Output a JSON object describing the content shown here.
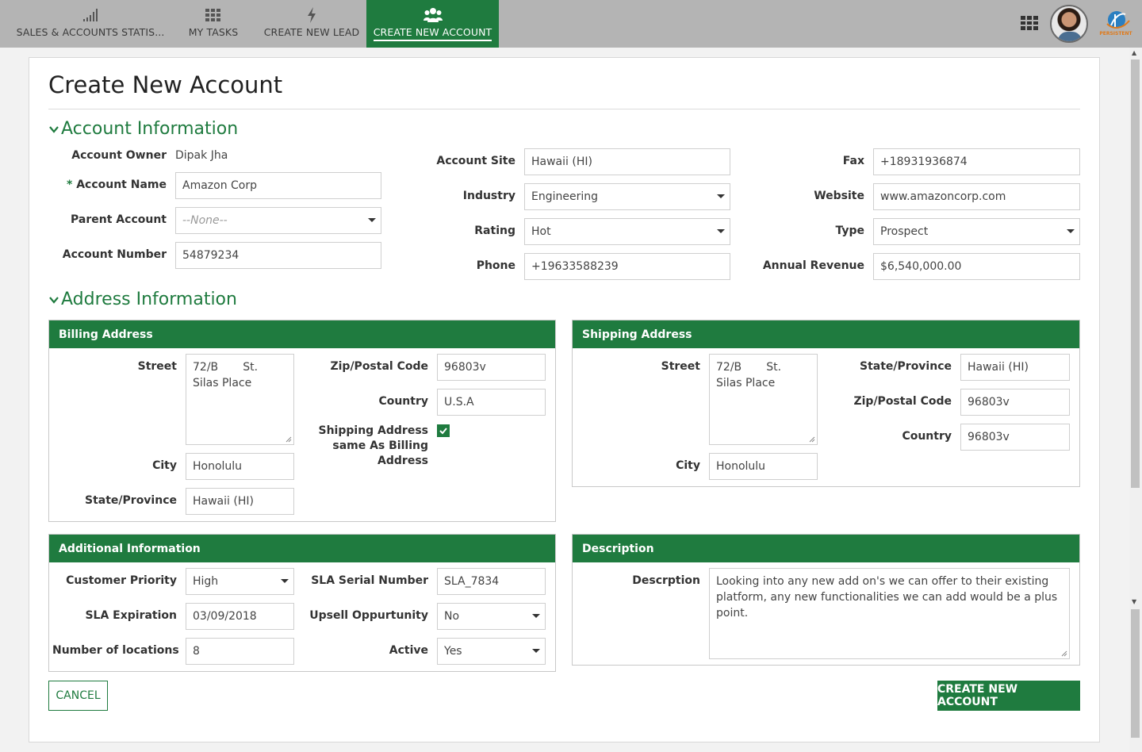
{
  "nav": {
    "tabs": [
      {
        "label": "SALES & ACCOUNTS STATIS...",
        "icon": "signal-bars-icon"
      },
      {
        "label": "MY TASKS",
        "icon": "grid-icon"
      },
      {
        "label": "CREATE NEW LEAD",
        "icon": "lightning-icon"
      },
      {
        "label": "CREATE NEW ACCOUNT",
        "icon": "users-icon"
      }
    ],
    "active_tab": "CREATE NEW ACCOUNT",
    "logo_text": "PERSISTENT"
  },
  "page": {
    "title": "Create New Account"
  },
  "account_info": {
    "heading": "Account Information",
    "owner_label": "Account Owner",
    "owner_value": "Dipak Jha",
    "required_mark": "*",
    "name_label": "Account Name",
    "name_value": "Amazon Corp",
    "parent_label": "Parent Account",
    "parent_value": "--None--",
    "number_label": "Account Number",
    "number_value": "54879234",
    "site_label": "Account Site",
    "site_value": "Hawaii (HI)",
    "industry_label": "Industry",
    "industry_value": "Engineering",
    "rating_label": "Rating",
    "rating_value": "Hot",
    "phone_label": "Phone",
    "phone_value": "+19633588239",
    "fax_label": "Fax",
    "fax_value": "+18931936874",
    "website_label": "Website",
    "website_value": "www.amazoncorp.com",
    "type_label": "Type",
    "type_value": "Prospect",
    "revenue_label": "Annual Revenue",
    "revenue_value": "$6,540,000.00"
  },
  "address_info": {
    "heading": "Address Information",
    "billing": {
      "title": "Billing Address",
      "street_label": "Street",
      "street_value": "72/B       St.\nSilas Place",
      "city_label": "City",
      "city_value": "Honolulu",
      "state_label": "State/Province",
      "state_value": "Hawaii (HI)",
      "zip_label": "Zip/Postal Code",
      "zip_value": "96803v",
      "country_label": "Country",
      "country_value": "U.S.A",
      "same_label_1": "Shipping Address",
      "same_label_2": "same As Billing",
      "same_label_3": "Address",
      "same_checked": true
    },
    "shipping": {
      "title": "Shipping Address",
      "street_label": "Street",
      "street_value": "72/B       St.\nSilas Place",
      "city_label": "City",
      "city_value": "Honolulu",
      "state_label": "State/Province",
      "state_value": "Hawaii (HI)",
      "zip_label": "Zip/Postal Code",
      "zip_value": "96803v",
      "country_label": "Country",
      "country_value": "96803v"
    }
  },
  "additional": {
    "title": "Additional Information",
    "priority_label": "Customer Priority",
    "priority_value": "High",
    "sla_exp_label": "SLA Expiration",
    "sla_exp_value": "03/09/2018",
    "locations_label": "Number of locations",
    "locations_value": "8",
    "sla_serial_label": "SLA Serial Number",
    "sla_serial_value": "SLA_7834",
    "upsell_label": "Upsell Oppurtunity",
    "upsell_value": "No",
    "active_label": "Active",
    "active_value": "Yes"
  },
  "description": {
    "title": "Description",
    "label": "Descrption",
    "value": "Looking into any new add on's we can offer to their existing platform, any new functionalities we can add would be a plus point."
  },
  "actions": {
    "cancel": "CANCEL",
    "create": "CREATE NEW ACCOUNT"
  },
  "colors": {
    "brand": "#1f7b3f",
    "topbar": "#b4b4b4"
  }
}
